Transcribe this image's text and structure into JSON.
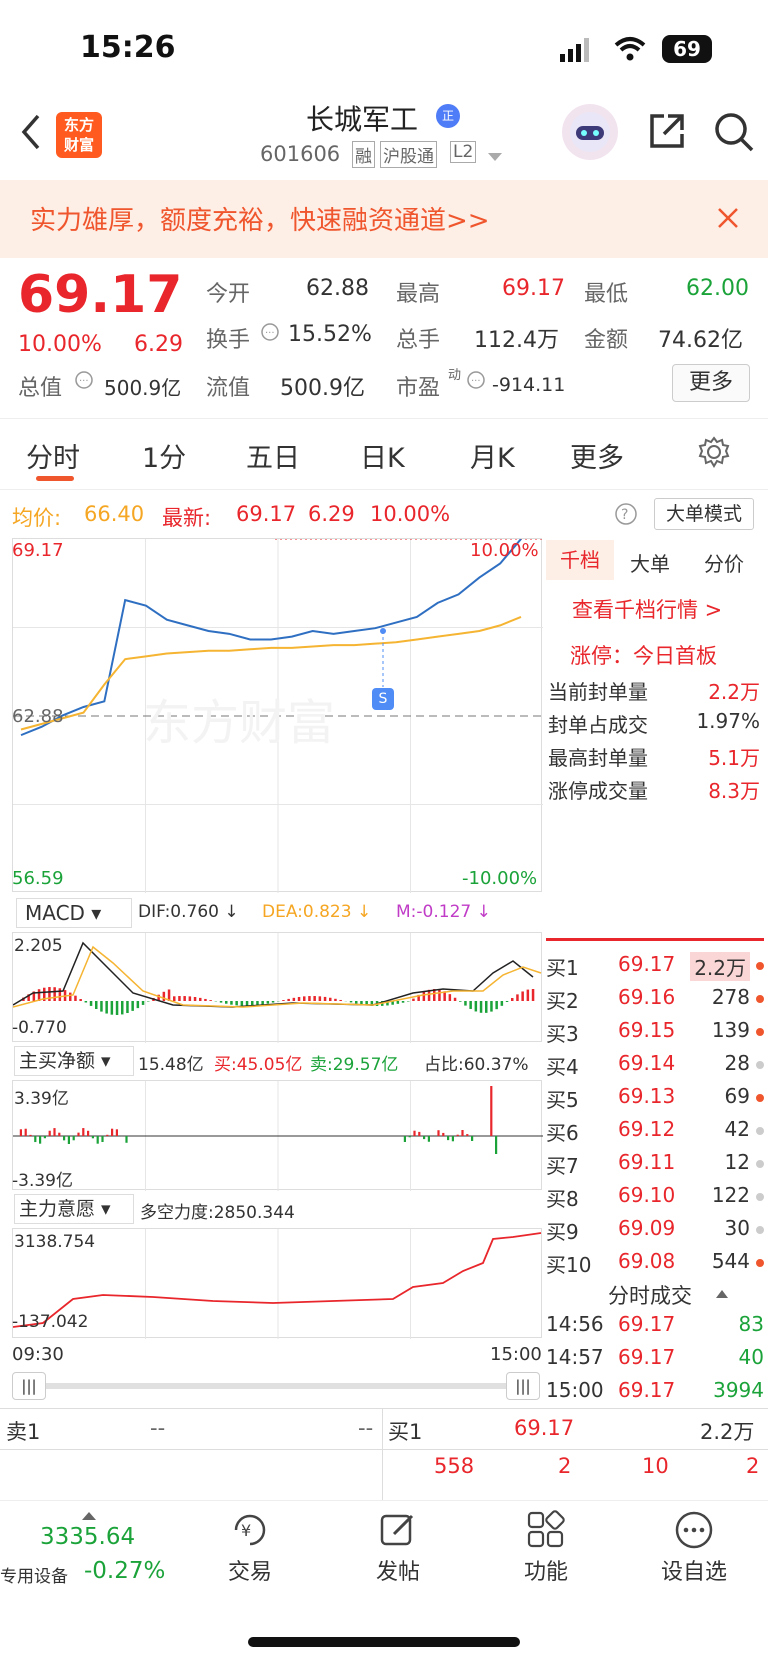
{
  "status": {
    "time": "15:26",
    "battery": "69"
  },
  "header": {
    "name": "长城军工",
    "code": "601606",
    "tags": [
      "融",
      "沪股通",
      "L2"
    ],
    "logo_text": [
      "东方",
      "财富"
    ],
    "verified": "正"
  },
  "banner": {
    "text": "实力雄厚，额度充裕，快速融资通道>>"
  },
  "quote": {
    "price": "69.17",
    "pct": "10.00%",
    "change": "6.29",
    "open_label": "今开",
    "open": "62.88",
    "high_label": "最高",
    "high": "69.17",
    "low_label": "最低",
    "low": "62.00",
    "turnover_label": "换手",
    "turnover": "15.52%",
    "volume_label": "总手",
    "volume": "112.4万",
    "amount_label": "金额",
    "amount": "74.62亿",
    "mktcap_label": "总值",
    "mktcap": "500.9亿",
    "float_label": "流值",
    "float": "500.9亿",
    "pe_label": "市盈",
    "pe_sup": "动",
    "pe": "-914.11",
    "more_button": "更多"
  },
  "tabs": [
    "分时",
    "1分",
    "五日",
    "日K",
    "月K",
    "更多"
  ],
  "chart_info": {
    "avg_label": "均价:",
    "avg": "66.40",
    "latest_label": "最新:",
    "latest": "69.17",
    "latest_change": "6.29",
    "latest_pct": "10.00%",
    "mode_button": "大单模式"
  },
  "chart_data": [
    {
      "type": "line",
      "title": "",
      "series": [
        {
          "name": "price",
          "values": [
            62.2,
            62.5,
            62.9,
            63.2,
            63.4,
            67.0,
            66.8,
            66.3,
            66.1,
            65.9,
            65.8,
            65.6,
            65.6,
            65.7,
            65.9,
            65.8,
            65.9,
            66.0,
            66.2,
            66.4,
            66.9,
            67.2,
            67.8,
            68.3,
            69.17
          ]
        },
        {
          "name": "avg",
          "values": [
            62.4,
            62.6,
            62.8,
            63.0,
            64.0,
            64.9,
            65.0,
            65.1,
            65.15,
            65.2,
            65.2,
            65.25,
            65.3,
            65.3,
            65.35,
            65.4,
            65.4,
            65.45,
            65.5,
            65.6,
            65.7,
            65.8,
            65.9,
            66.1,
            66.4
          ]
        }
      ],
      "ylim": [
        56.59,
        69.17
      ],
      "y_left_top": "69.17",
      "y_left_ref": "62.88",
      "y_left_bottom": "56.59",
      "y_right_top": "10.00%",
      "y_right_bottom": "-10.00%"
    },
    {
      "type": "line",
      "title": "MACD",
      "dif": "DIF:0.760 ↓",
      "dea": "DEA:0.823 ↓",
      "m": "M:-0.127 ↓",
      "top": "2.205",
      "bottom": "-0.770"
    },
    {
      "type": "bar",
      "title": "主买净额",
      "total": "15.48亿",
      "buy": "买:45.05亿",
      "sell": "卖:29.57亿",
      "ratio": "占比:60.37%",
      "top": "3.39亿",
      "bottom": "-3.39亿"
    },
    {
      "type": "line",
      "title": "主力意愿",
      "power": "多空力度:2850.344",
      "top": "3138.754",
      "bottom": "-137.042",
      "x_start": "09:30",
      "x_end": "15:00"
    }
  ],
  "side": {
    "tabs": [
      "千档",
      "大单",
      "分价"
    ],
    "link": "查看千档行情 >",
    "limit_label": "涨停：今日首板",
    "rows": [
      {
        "label": "当前封单量",
        "value": "2.2万"
      },
      {
        "label": "封单占成交",
        "value": "1.97%"
      },
      {
        "label": "最高封单量",
        "value": "5.1万"
      },
      {
        "label": "涨停成交量",
        "value": "8.3万"
      }
    ],
    "buys": [
      {
        "label": "买1",
        "price": "69.17",
        "vol": "2.2万"
      },
      {
        "label": "买2",
        "price": "69.16",
        "vol": "278"
      },
      {
        "label": "买3",
        "price": "69.15",
        "vol": "139"
      },
      {
        "label": "买4",
        "price": "69.14",
        "vol": "28"
      },
      {
        "label": "买5",
        "price": "69.13",
        "vol": "69"
      },
      {
        "label": "买6",
        "price": "69.12",
        "vol": "42"
      },
      {
        "label": "买7",
        "price": "69.11",
        "vol": "12"
      },
      {
        "label": "买8",
        "price": "69.10",
        "vol": "122"
      },
      {
        "label": "买9",
        "price": "69.09",
        "vol": "30"
      },
      {
        "label": "买10",
        "price": "69.08",
        "vol": "544"
      }
    ],
    "ticks_title": "分时成交",
    "ticks": [
      {
        "t": "14:56",
        "p": "69.17",
        "v": "83"
      },
      {
        "t": "14:57",
        "p": "69.17",
        "v": "40"
      },
      {
        "t": "15:00",
        "p": "69.17",
        "v": "3994"
      }
    ]
  },
  "orderbar": {
    "sell_label": "卖1",
    "sell_p": "--",
    "sell_v": "--",
    "buy_label": "买1",
    "buy_p": "69.17",
    "buy_v": "2.2万",
    "nums": [
      "558",
      "2",
      "10",
      "2"
    ]
  },
  "bottom": {
    "index": "3335.64",
    "device": "专用设备",
    "device_pct": "-0.27%",
    "items": [
      "交易",
      "发帖",
      "功能",
      "设自选"
    ]
  }
}
